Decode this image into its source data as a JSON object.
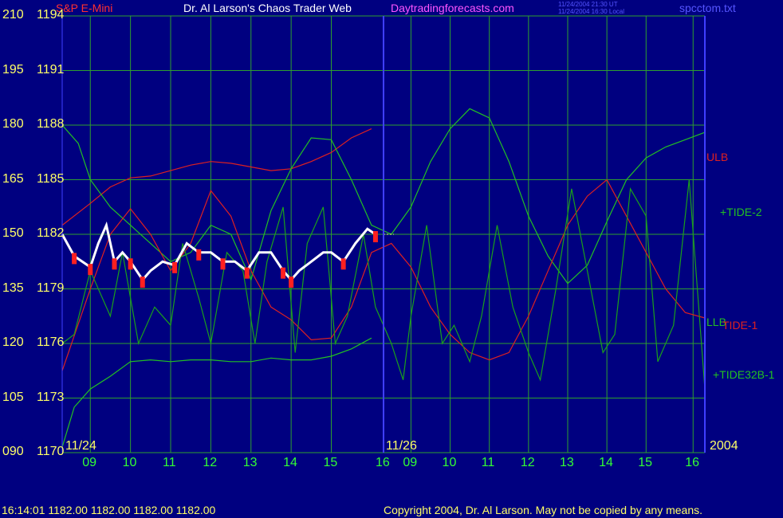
{
  "header": {
    "symbol": "S&P E-Mini",
    "title": "Dr. Al Larson's Chaos Trader Web",
    "site": "Daytradingforecasts.com",
    "time_ut": "11/24/2004 21:30 UT",
    "time_local": "11/24/2004 16:30 Local",
    "filename": "spcctom.txt"
  },
  "footer": {
    "quote": "16:14:01  1182.00 1182.00 1182.00 1182.00",
    "copyright": "Copyright 2004, Dr. Al Larson. May not be copied by any means."
  },
  "colors": {
    "background": "#000080",
    "grid": "#2ea02e",
    "axis": "#3f3fff",
    "price_up": "#ffffff",
    "price_down": "#ff2020",
    "green_series": "#22c022",
    "red_series": "#dd2020",
    "label_yellow": "#ffff66"
  },
  "chart_data": {
    "type": "line",
    "title": "S&P E-Mini",
    "y_left_labels": [
      "210",
      "195",
      "180",
      "165",
      "150",
      "135",
      "120",
      "105",
      "090"
    ],
    "y_right_labels": [
      "1194",
      "1191",
      "1188",
      "1185",
      "1182",
      "1179",
      "1176",
      "1173",
      "1170"
    ],
    "ylim_price": [
      1170,
      1194
    ],
    "ylim_index": [
      90,
      210
    ],
    "date_labels": [
      "11/24",
      "11/26",
      "2004"
    ],
    "x_ticks": [
      "09",
      "10",
      "11",
      "12",
      "13",
      "14",
      "15",
      "16",
      "09",
      "10",
      "11",
      "12",
      "13",
      "14",
      "15",
      "16"
    ],
    "series_labels": [
      "ULB",
      "+TIDE-2",
      "LLB",
      "TIDE-1",
      "+TIDE32B-1"
    ],
    "grid": true,
    "series": [
      {
        "name": "ULB",
        "x": [
          8.3,
          9,
          9.5,
          10,
          10.5,
          11,
          11.5,
          12,
          12.5,
          13,
          13.5,
          14,
          14.5,
          15,
          15.5,
          16
        ],
        "y": [
          1182.5,
          1183.7,
          1184.6,
          1185.1,
          1185.2,
          1185.5,
          1185.8,
          1186,
          1185.9,
          1185.7,
          1185.5,
          1185.6,
          1186.0,
          1186.5,
          1187.3,
          1187.8
        ]
      },
      {
        "name": "LLB",
        "x": [
          8.3,
          8.6,
          9,
          9.5,
          10,
          10.5,
          11,
          11.5,
          12,
          12.5,
          13,
          13.5,
          14,
          14.5,
          15,
          15.5,
          16
        ],
        "y": [
          1170.3,
          1172.5,
          1173.5,
          1174.2,
          1175.0,
          1175.1,
          1175.0,
          1175.1,
          1175.1,
          1175.0,
          1175.0,
          1175.2,
          1175.1,
          1175.1,
          1175.3,
          1175.7,
          1176.3
        ]
      },
      {
        "name": "+TIDE-2",
        "x": [
          8.3,
          8.7,
          9,
          9.5,
          10,
          10.5,
          11,
          11.5,
          12,
          12.5,
          13,
          13.5,
          14,
          14.5,
          15,
          15.5,
          16,
          16.5,
          17,
          17.5,
          18,
          18.5,
          19,
          19.5,
          20,
          20.5,
          21,
          21.5,
          22,
          22.5,
          23,
          23.5,
          24,
          24.5
        ],
        "y": [
          1188,
          1187,
          1185,
          1183.5,
          1182.5,
          1181.5,
          1180.5,
          1181,
          1182.5,
          1182,
          1179.5,
          1183.3,
          1185.6,
          1187.3,
          1187.2,
          1185,
          1182.5,
          1182,
          1183.5,
          1186,
          1187.8,
          1188.9,
          1188.4,
          1186,
          1183,
          1180.8,
          1179.3,
          1180.3,
          1182.7,
          1185,
          1186.2,
          1186.8,
          1187.2,
          1187.6
        ]
      },
      {
        "name": "TIDE-1",
        "x": [
          8.3,
          9,
          9.5,
          10,
          10.5,
          11,
          11.5,
          12,
          12.5,
          13,
          13.5,
          14,
          14.5,
          15,
          15.5,
          16,
          16.5,
          17,
          17.5,
          18,
          18.5,
          19,
          19.5,
          20,
          20.5,
          21,
          21.5,
          22,
          22.5,
          23,
          23.5,
          24,
          24.5
        ],
        "y": [
          1174.5,
          1179,
          1182,
          1183.4,
          1182,
          1180,
          1181.5,
          1184.4,
          1183,
          1180,
          1178,
          1177.3,
          1176.2,
          1176.3,
          1178,
          1181,
          1181.5,
          1180.2,
          1178,
          1176.5,
          1175.5,
          1175.1,
          1175.5,
          1177.5,
          1180,
          1182.5,
          1184.1,
          1185,
          1183,
          1181,
          1179,
          1177.7,
          1177.4
        ]
      },
      {
        "name": "+TIDE32B-1",
        "x": [
          8.3,
          8.6,
          9,
          9.5,
          9.8,
          10.2,
          10.6,
          11,
          11.3,
          11.7,
          12,
          12.4,
          12.8,
          13.1,
          13.4,
          13.8,
          14.1,
          14.4,
          14.8,
          15.1,
          15.4,
          15.8,
          16.1,
          16.5,
          16.8,
          17,
          17.4,
          17.8,
          18.1,
          18.5,
          18.8,
          19.2,
          19.6,
          20,
          20.3,
          20.7,
          21.1,
          21.5,
          21.9,
          22.2,
          22.6,
          23,
          23.3,
          23.7,
          24.1,
          24.5
        ],
        "y": [
          1176,
          1176.5,
          1180,
          1177.5,
          1181,
          1176,
          1178,
          1177,
          1181.5,
          1178.5,
          1176,
          1181,
          1180,
          1176,
          1180.5,
          1183.5,
          1175.5,
          1181.5,
          1183.5,
          1176,
          1177.5,
          1182,
          1178,
          1176,
          1174,
          1177.5,
          1182.5,
          1176,
          1177,
          1175,
          1177.5,
          1182.5,
          1178,
          1175.5,
          1174,
          1179,
          1184.5,
          1180,
          1175.5,
          1176.5,
          1184.5,
          1183,
          1175,
          1177,
          1185,
          1173.5
        ]
      },
      {
        "name": "Price",
        "x": [
          8.3,
          8.6,
          9,
          9.2,
          9.4,
          9.6,
          9.8,
          10,
          10.3,
          10.5,
          10.8,
          11.1,
          11.4,
          11.7,
          12,
          12.3,
          12.6,
          12.9,
          13.2,
          13.5,
          13.8,
          14,
          14.2,
          14.5,
          14.8,
          15,
          15.3,
          15.6,
          15.9,
          16.1
        ],
        "y": [
          1182,
          1180.8,
          1180.2,
          1181.5,
          1182.5,
          1180.5,
          1181,
          1180.5,
          1179.5,
          1180,
          1180.5,
          1180.3,
          1181.5,
          1181,
          1181,
          1180.5,
          1180.5,
          1180,
          1181,
          1181,
          1180,
          1179.5,
          1180,
          1180.5,
          1181,
          1181,
          1180.5,
          1181.5,
          1182.3,
          1182
        ]
      }
    ]
  }
}
